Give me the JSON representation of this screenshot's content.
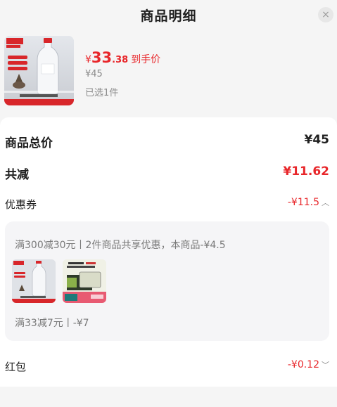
{
  "header": {
    "title": "商品明细",
    "close_symbol": "×"
  },
  "product": {
    "price_symbol": "¥",
    "price_int": "33",
    "price_dec": ".38",
    "price_tag": "到手价",
    "original_price": "¥45",
    "selected_text": "已选1件"
  },
  "summary": {
    "total_label": "商品总价",
    "total_value": "¥45",
    "reduce_label": "共减",
    "reduce_value": "¥11.62",
    "coupon_label": "优惠券",
    "coupon_value": "-¥11.5",
    "coupon_detail": {
      "rule1": "满300减30元丨2件商品共享优惠，本商品-¥4.5",
      "rule2": "满33减7元丨-¥7"
    },
    "hongbao_label": "红包",
    "hongbao_value": "-¥0.12"
  },
  "colors": {
    "accent": "#e8262a",
    "background": "#f5f5f5",
    "card": "#ffffff"
  },
  "icons": {
    "close": "close-icon",
    "coupon_toggle": "chevron-up-icon",
    "hongbao_toggle": "chevron-down-icon"
  }
}
